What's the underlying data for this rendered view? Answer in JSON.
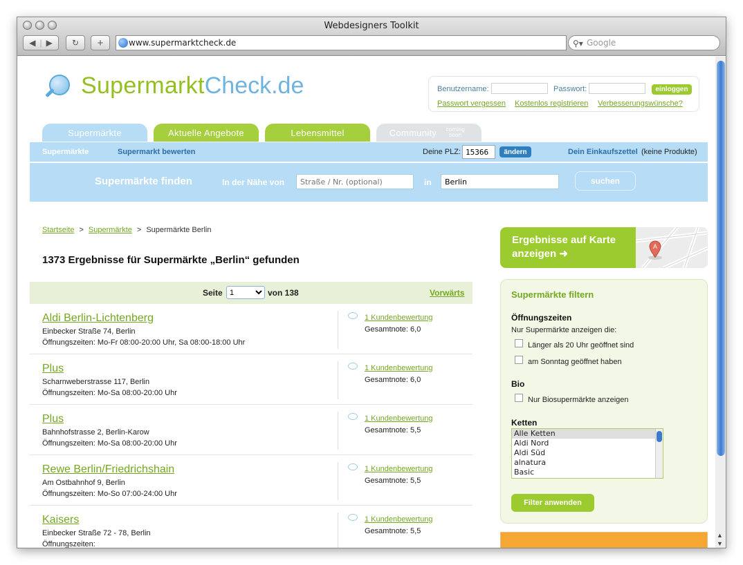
{
  "browser": {
    "window_title": "Webdesigners Toolkit",
    "url": "www.supermarktcheck.de",
    "search_placeholder": "Google"
  },
  "site": {
    "logo_part1": "Supermarkt",
    "logo_part2": "Check.de"
  },
  "login": {
    "username_label": "Benutzername:",
    "password_label": "Passwort:",
    "login_button": "einloggen",
    "forgot_link": "Passwort vergessen",
    "register_link": "Kostenlos registrieren",
    "suggestions_link": "Verbesserungswünsche?"
  },
  "tabs": [
    {
      "label": "Supermärkte"
    },
    {
      "label": "Aktuelle Angebote"
    },
    {
      "label": "Lebensmittel"
    },
    {
      "label": "Community",
      "badge": "coming soon"
    }
  ],
  "subnav": {
    "item1": "Supermärkte",
    "item2": "Supermarkt bewerten",
    "plz_label": "Deine PLZ:",
    "plz_value": "15366",
    "change_button": "ändern",
    "shopping_list": "Dein Einkaufszettel",
    "shopping_count": "(keine Produkte)"
  },
  "find": {
    "title": "Supermärkte finden",
    "near_label": "In der Nähe von",
    "street_placeholder": "Straße / Nr. (optional)",
    "in_label": "in",
    "city_value": "Berlin",
    "search_button": "suchen"
  },
  "breadcrumb": {
    "home": "Startseite",
    "sep": ">",
    "section": "Supermärkte",
    "current": "Supermärkte Berlin"
  },
  "results": {
    "heading": "1373 Ergebnisse für Supermärkte „Berlin“ gefunden",
    "page_label": "Seite",
    "page_value": "1",
    "of_label": "von 138",
    "next": "Vorwärts",
    "items": [
      {
        "name": "Aldi Berlin-Lichtenberg",
        "address": "Einbecker Straße 74, Berlin",
        "hours": "Öffnungszeiten: Mo-Fr 08:00-20:00 Uhr, Sa 08:00-18:00 Uhr",
        "reviews": "1 Kundenbewertung",
        "grade": "Gesamtnote: 6,0"
      },
      {
        "name": "Plus",
        "address": "Scharnweberstrasse 117, Berlin",
        "hours": "Öffnungszeiten: Mo-Sa 08:00-20:00 Uhr",
        "reviews": "1 Kundenbewertung",
        "grade": "Gesamtnote: 6,0"
      },
      {
        "name": "Plus",
        "address": "Bahnhofstrasse 2, Berlin-Karow",
        "hours": "Öffnungszeiten: Mo-Sa 08:00-20:00 Uhr",
        "reviews": "1 Kundenbewertung",
        "grade": "Gesamtnote: 5,5"
      },
      {
        "name": "Rewe Berlin/Friedrichshain",
        "address": "Am Ostbahnhof 9, Berlin",
        "hours": "Öffnungszeiten: Mo-So 07:00-24:00 Uhr",
        "reviews": "1 Kundenbewertung",
        "grade": "Gesamtnote: 5,5"
      },
      {
        "name": "Kaisers",
        "address": "Einbecker Straße 72 - 78, Berlin",
        "hours": "Öffnungszeiten:",
        "reviews": "1 Kundenbewertung",
        "grade": "Gesamtnote: 5,5"
      }
    ]
  },
  "map_box": {
    "line1": "Ergebnisse auf Karte",
    "line2": "anzeigen ➜",
    "marker_label": "A"
  },
  "filter": {
    "title": "Supermärkte filtern",
    "hours_title": "Öffnungszeiten",
    "hours_hint": "Nur Supermärkte anzeigen die:",
    "opt_late": "Länger als 20 Uhr geöffnet sind",
    "opt_sunday": "am Sonntag geöffnet haben",
    "bio_title": "Bio",
    "opt_bio": "Nur Biosupermärkte anzeigen",
    "chains_title": "Ketten",
    "chains": [
      "Alle Ketten",
      "Aldi Nord",
      "Aldi Süd",
      "alnatura",
      "Basic"
    ],
    "apply_button": "Filter anwenden"
  },
  "colors": {
    "green": "#9bcb2e",
    "link_green": "#74a821",
    "light_blue": "#b6dcf6",
    "logo_blue": "#6fb3e0"
  }
}
